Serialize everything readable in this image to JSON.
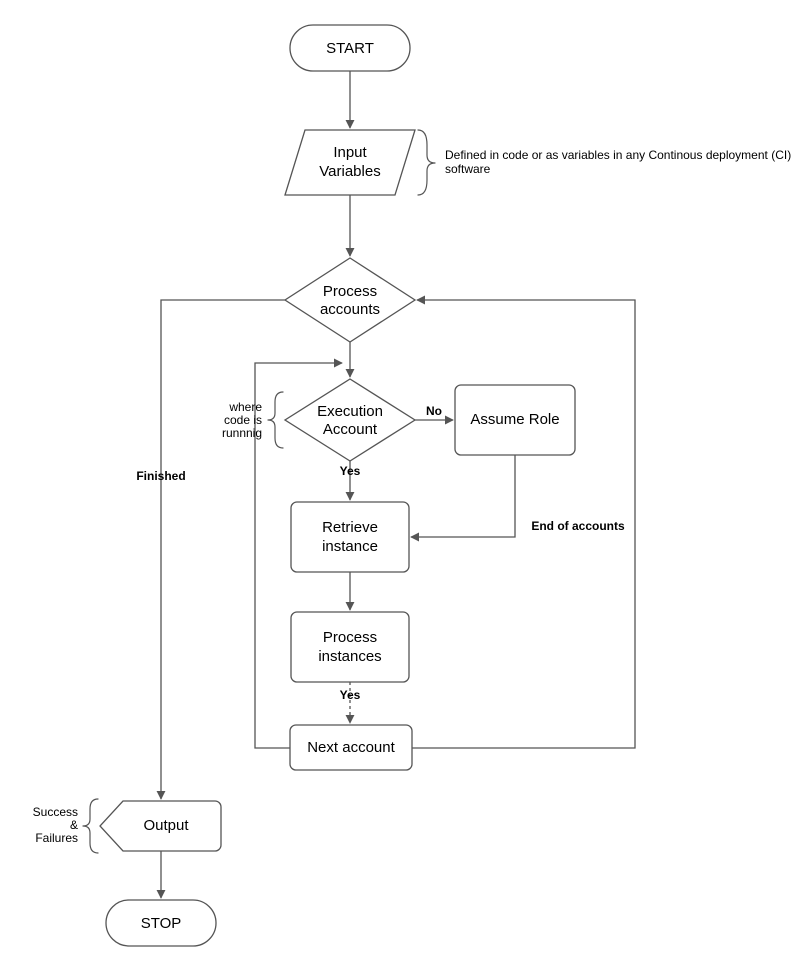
{
  "nodes": {
    "start": "START",
    "input_variables_l1": "Input",
    "input_variables_l2": "Variables",
    "process_accounts_l1": "Process",
    "process_accounts_l2": "accounts",
    "execution_account_l1": "Execution",
    "execution_account_l2": "Account",
    "assume_role": "Assume Role",
    "retrieve_instance_l1": "Retrieve",
    "retrieve_instance_l2": "instance",
    "process_instances_l1": "Process",
    "process_instances_l2": "instances",
    "next_account": "Next account",
    "output": "Output",
    "stop": "STOP"
  },
  "edges": {
    "finished": "Finished",
    "no": "No",
    "yes": "Yes",
    "yes2": "Yes",
    "end_of_accounts": "End of accounts"
  },
  "notes": {
    "ci_l1": "Defined in code or as variables in any Continous deployment (CI)",
    "ci_l2": "software",
    "where_code_l1": "where",
    "where_code_l2": "code is",
    "where_code_l3": "runnnig",
    "output_l1": "Success",
    "output_l2": "&",
    "output_l3": "Failures"
  }
}
